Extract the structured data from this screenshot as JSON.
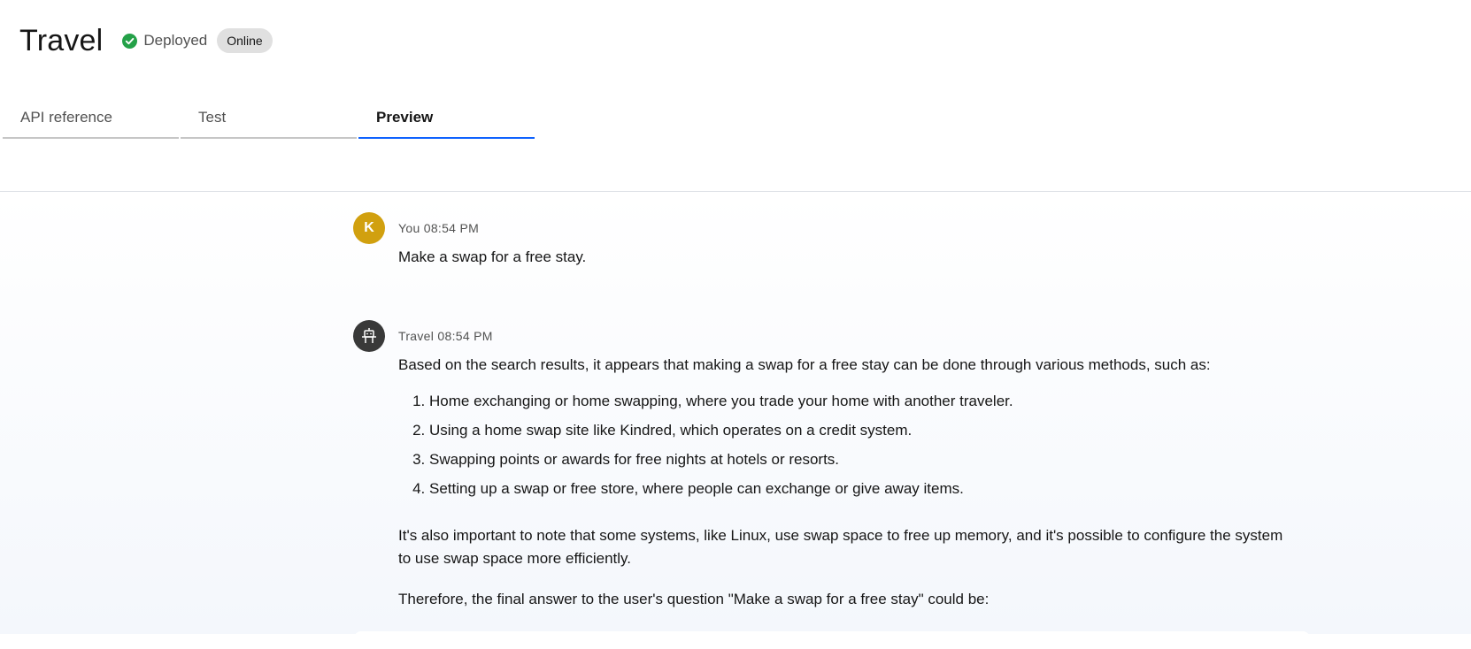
{
  "header": {
    "title": "Travel",
    "status_label": "Deployed",
    "status_color": "#24a148",
    "badge": "Online"
  },
  "tabs": [
    {
      "label": "API reference",
      "active": false
    },
    {
      "label": "Test",
      "active": false
    },
    {
      "label": "Preview",
      "active": true
    }
  ],
  "accent_color": "#0f62fe",
  "messages": [
    {
      "avatar_letter": "K",
      "avatar_color": "#d1a00f",
      "sender": "You",
      "time": "08:54 PM",
      "text": "Make a swap for a free stay."
    },
    {
      "avatar_icon": "robot-icon",
      "sender": "Travel",
      "time": "08:54 PM",
      "intro": "Based on the search results, it appears that making a swap for a free stay can be done through various methods, such as:",
      "list": [
        "Home exchanging or home swapping, where you trade your home with another traveler.",
        "Using a home swap site like Kindred, which operates on a credit system.",
        "Swapping points or awards for free nights at hotels or resorts.",
        "Setting up a swap or free store, where people can exchange or give away items."
      ],
      "para2": "It's also important to note that some systems, like Linux, use swap space to free up memory, and it's possible to configure the system to use swap space more efficiently.",
      "para3": "Therefore, the final answer to the user's question \"Make a swap for a free stay\" could be:"
    }
  ]
}
